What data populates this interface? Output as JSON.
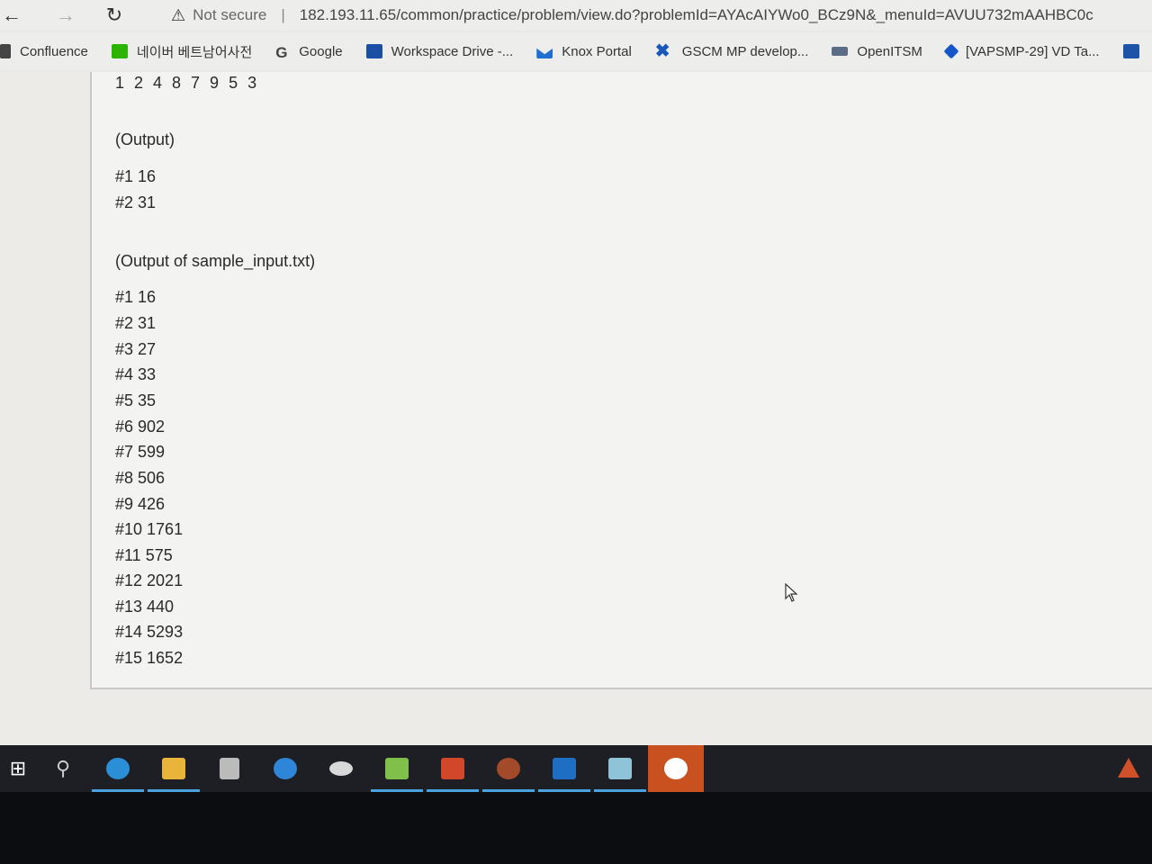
{
  "browser": {
    "back_icon": "arrow-left-icon",
    "reload_icon": "reload-icon",
    "security_text": "Not secure",
    "url": "182.193.11.65/common/practice/problem/view.do?problemId=AYAcAIYWo0_BCz9N&_menuId=AVUU732mAAHBC0c"
  },
  "bookmarks": [
    {
      "label": "Confluence",
      "icon": "confluence-icon"
    },
    {
      "label": "네이버 베트남어사전",
      "icon": "naver-dictionary-icon"
    },
    {
      "label": "Google",
      "icon": "google-icon"
    },
    {
      "label": "Workspace Drive -...",
      "icon": "folder-icon"
    },
    {
      "label": "Knox Portal",
      "icon": "knox-icon"
    },
    {
      "label": "GSCM MP develop...",
      "icon": "gscm-icon"
    },
    {
      "label": "OpenITSM",
      "icon": "openitsm-icon"
    },
    {
      "label": "[VAPSMP-29] VD Ta...",
      "icon": "jira-icon"
    }
  ],
  "content": {
    "sequence": "1 2 4 8 7 9 5 3",
    "output_heading": "(Output)",
    "output_lines": [
      "#1 16",
      "#2 31"
    ],
    "sample_heading": "(Output of sample_input.txt)",
    "sample_lines": [
      "#1 16",
      "#2 31",
      "#3 27",
      "#4 33",
      "#5 35",
      "#6 902",
      "#7 599",
      "#8 506",
      "#9 426",
      "#10 1761",
      "#11 575",
      "#12 2021",
      "#13 440",
      "#14 5293",
      "#15 1652"
    ]
  },
  "taskbar": {
    "apps": [
      "windows-start-icon",
      "search-icon",
      "edge-icon",
      "file-explorer-icon",
      "app-grid-icon",
      "internet-explorer-icon",
      "cloud-app-icon",
      "charts-app-icon",
      "powerpoint-icon",
      "settings-gear-app-icon",
      "media-player-icon",
      "notes-app-icon",
      "jira-app-icon"
    ]
  }
}
